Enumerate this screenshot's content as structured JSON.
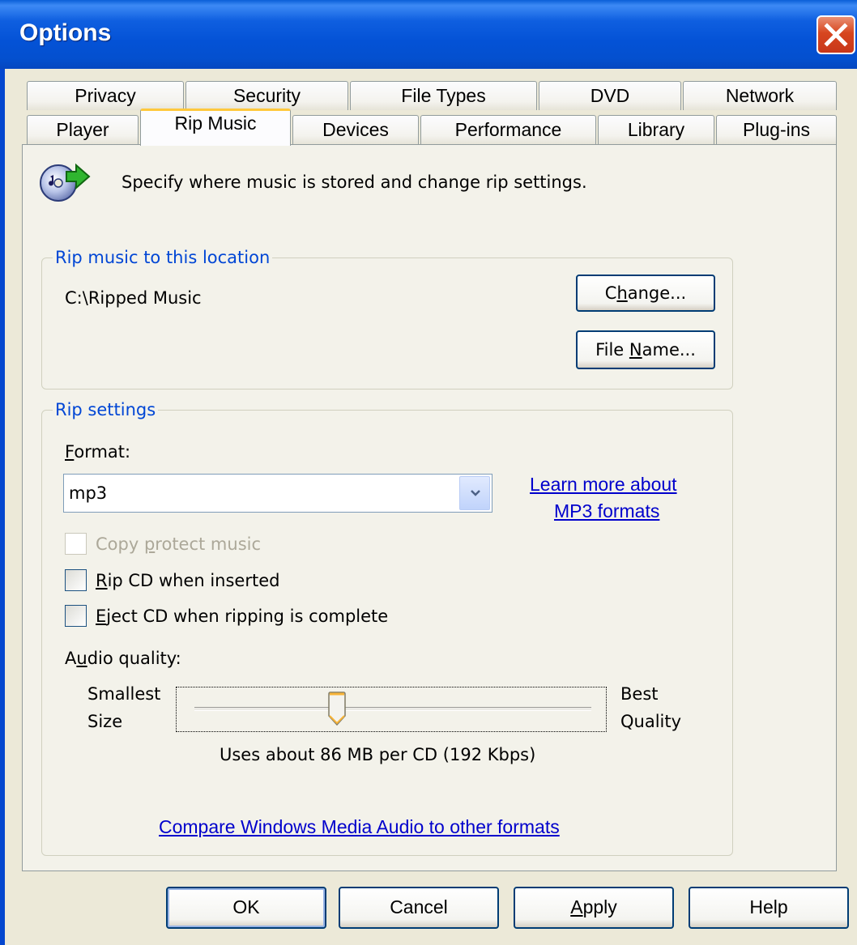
{
  "window": {
    "title": "Options"
  },
  "tabs": {
    "row1": [
      "Privacy",
      "Security",
      "File Types",
      "DVD",
      "Network"
    ],
    "row2": [
      "Player",
      "Rip Music",
      "Devices",
      "Performance",
      "Library",
      "Plug-ins"
    ],
    "active": "Rip Music"
  },
  "header": {
    "description": "Specify where music is stored and change rip settings.",
    "icon": "rip-music-cd-icon"
  },
  "location_group": {
    "label": "Rip music to this location",
    "path": "C:\\Ripped Music",
    "change_button": {
      "pre": "C",
      "u": "h",
      "post": "ange..."
    },
    "filename_button": {
      "pre": "File ",
      "u": "N",
      "post": "ame..."
    }
  },
  "settings_group": {
    "label": "Rip settings",
    "format_label": {
      "u": "F",
      "post": "ormat:"
    },
    "format_value": "mp3",
    "learn_more_line1": "Learn more about",
    "learn_more_line2": "MP3 formats",
    "copy_protect": {
      "pre": "Copy ",
      "u": "p",
      "post": "rotect music",
      "checked": false,
      "disabled": true
    },
    "rip_cd": {
      "u": "R",
      "post": "ip CD when inserted",
      "checked": false
    },
    "eject_cd": {
      "u": "E",
      "post": "ject CD when ripping is complete",
      "checked": false
    },
    "audio_quality_label": {
      "pre": "A",
      "u": "u",
      "post": "dio quality:"
    },
    "smallest_line1": "Smallest",
    "smallest_line2": "Size",
    "best_line1": "Best",
    "best_line2": "Quality",
    "quality_level": 0.36,
    "usage_text": "Uses about 86 MB per CD (192 Kbps)",
    "compare_link": "Compare Windows Media Audio to other formats"
  },
  "footer": {
    "ok": "OK",
    "cancel": "Cancel",
    "apply": {
      "u": "A",
      "post": "pply"
    },
    "help": "Help"
  },
  "colors": {
    "titlebar": "#0452d6",
    "group_label": "#0046d5",
    "link": "#0000cc",
    "active_tab_accent": "#ffc83c"
  }
}
